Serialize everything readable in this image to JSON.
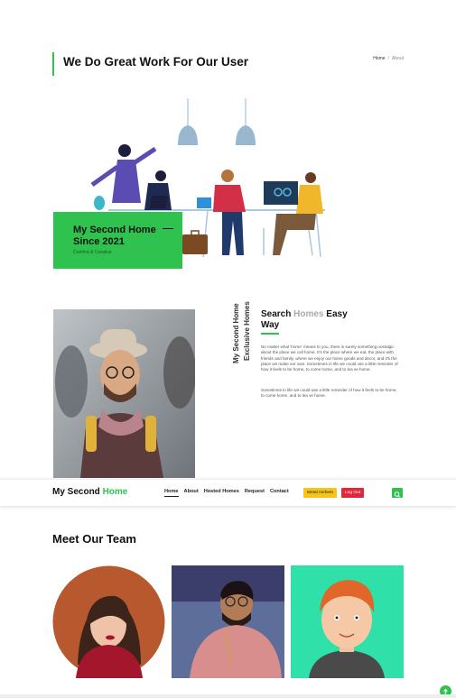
{
  "header": {
    "title": "We Do Great Work For Our User",
    "breadcrumb": {
      "home": "Home",
      "separator": "/",
      "current": "About"
    }
  },
  "hero": {
    "title_line1": "My Second Home",
    "title_line2": "Since 2021",
    "subtitle": "Comfort & Creative"
  },
  "about": {
    "vertical_line1": "My Second Home",
    "vertical_line2": "Exclusive Homes",
    "heading_part1": "Search ",
    "heading_muted": "Homes",
    "heading_part2": " Easy Way",
    "paragraph1": "No matter what 'home' means to you, there is surely something nostalgic about the place we call home. It's the place where we eat, the place with friends and family, where we enjoy our home goods and decor, and it's the place we make our own. Sometimes in life we could use a little reminder of how it feels to be home, to come home, and to lea ve home.",
    "paragraph2": "Sometimes in life we could use a little reminder of how it feels to be home, to come home, and to lea ve home."
  },
  "navbar": {
    "brand_part1": "My Second ",
    "brand_part2": "Home",
    "links": [
      "Home",
      "About",
      "Hosted Homes",
      "Request",
      "Contact"
    ],
    "metamask_label": "Metal mehest",
    "logout_label": "Log Out"
  },
  "team": {
    "heading": "Meet Our Team"
  },
  "colors": {
    "accent": "#2fc24f",
    "logout": "#e3263b",
    "metamask": "#f5c518"
  },
  "icons": {
    "search": "search-icon",
    "scroll_top": "arrow-up-icon"
  }
}
